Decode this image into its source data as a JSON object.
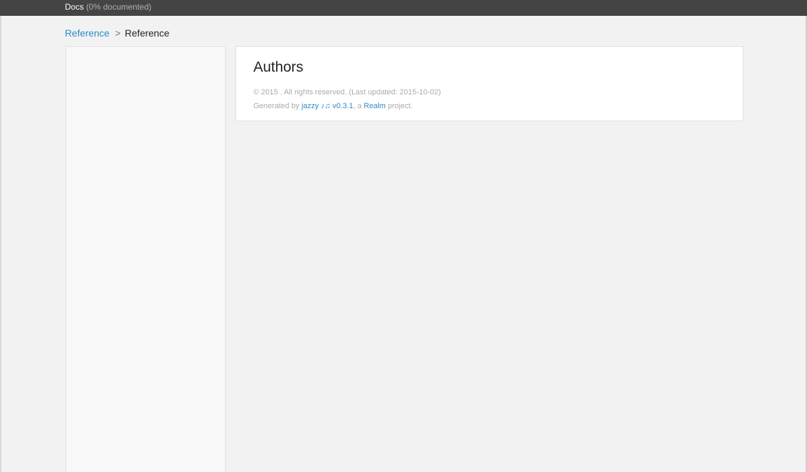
{
  "header": {
    "title": "Docs",
    "subtitle": "(0% documented)"
  },
  "breadcrumbs": {
    "link_label": "Reference",
    "separator": ">",
    "current_label": "Reference"
  },
  "main": {
    "heading": "Authors",
    "copyright": "© 2015 . All rights reserved. (Last updated: 2015-10-02)",
    "generated_prefix": "Generated by",
    "jazzy_link": "jazzy ♪♫ v0.3.1",
    "mid_text": ", a",
    "realm_link": "Realm",
    "suffix_text": "project."
  },
  "colors": {
    "header_bg": "#444444",
    "link": "#2a8bc8",
    "page_bg": "#f2f2f2"
  }
}
